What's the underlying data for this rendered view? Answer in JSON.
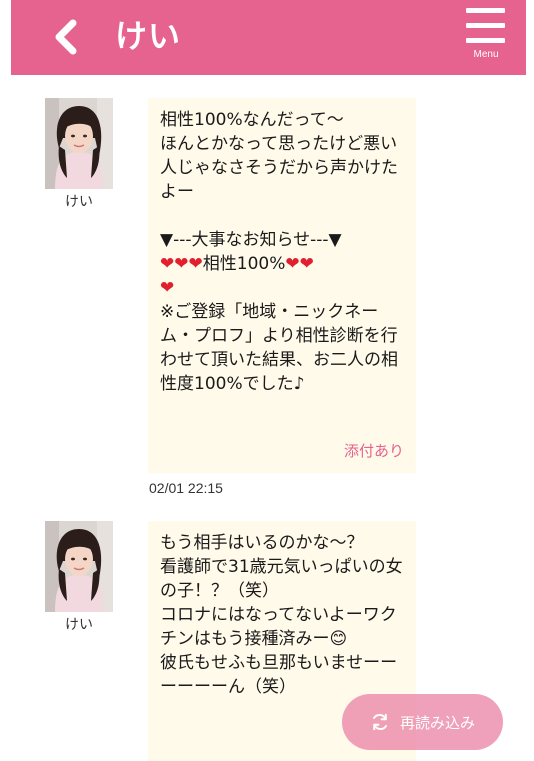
{
  "header": {
    "title": "けい",
    "menu_label": "Menu",
    "accent_color": "#e6628f"
  },
  "messages": [
    {
      "sender": "けい",
      "text": "相性100%なんだって〜\nほんとかなって思ったけど悪い人じゃなさそうだから声かけたよー\n\n▼---大事なお知らせ---▼\n❤❤❤相性100%❤❤\n❤\n※ご登録「地域・ニックネーム・プロフ」より相性診断を行わせて頂いた結果、お二人の相性度100%でした♪",
      "attachment_label": "添付あり",
      "timestamp": "02/01 22:15"
    },
    {
      "sender": "けい",
      "text": "もう相手はいるのかな〜？\n看護師で31歳元気いっぱいの女の子！？（笑）\nコロナにはなってないよーワクチンはもう接種済みー😊\n彼氏もせふも旦那もいませーーーーーーん（笑）"
    }
  ],
  "reload_button": {
    "label": "再読み込み",
    "icon": "refresh-icon"
  }
}
